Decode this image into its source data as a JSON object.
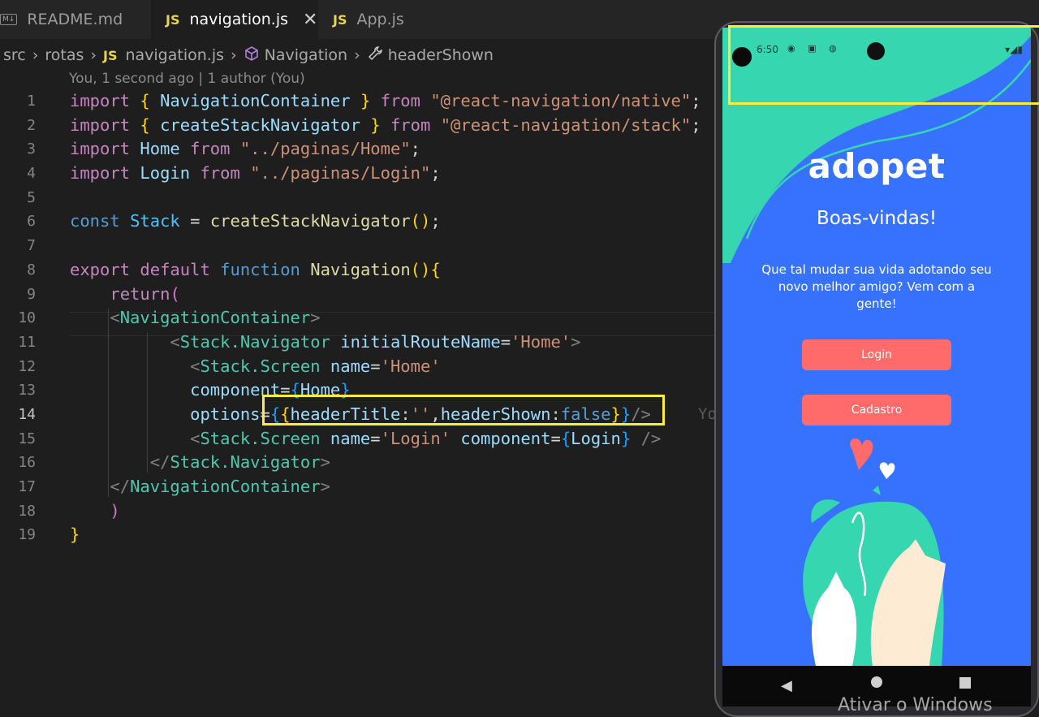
{
  "tabs": [
    {
      "icon": "M↓",
      "label": "README.md"
    },
    {
      "icon": "JS",
      "label": "navigation.js",
      "close": "✕"
    },
    {
      "icon": "JS",
      "label": "App.js"
    }
  ],
  "breadcrumb": {
    "parts": [
      "src",
      "rotas",
      "navigation.js",
      "Navigation",
      "headerShown"
    ],
    "js_icon": "JS"
  },
  "blame": "You, 1 second ago | 1 author (You)",
  "line_numbers": [
    "1",
    "2",
    "3",
    "4",
    "5",
    "6",
    "7",
    "8",
    "9",
    "10",
    "11",
    "12",
    "13",
    "14",
    "15",
    "16",
    "17",
    "18",
    "19"
  ],
  "ghost_text": "Yo",
  "phone": {
    "time": "6:50",
    "app_logo": "adopet",
    "welcome": "Boas-vindas!",
    "description": "Que tal mudar sua vida adotando seu novo melhor amigo? Vem com a gente!",
    "login_button": "Login",
    "signup_button": "Cadastro"
  },
  "watermark": "Ativar o Windows",
  "colors": {
    "editor_bg": "#1e1e1e",
    "highlight_box": "#ffeb3b",
    "app_blue": "#3772ff",
    "app_teal": "#36d6b0",
    "button_coral": "#ff6b6b"
  }
}
